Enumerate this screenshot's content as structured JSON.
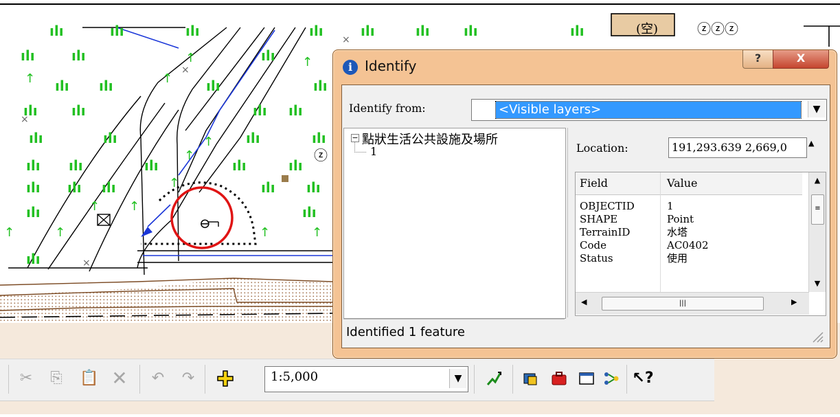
{
  "identify": {
    "title": "Identify",
    "help_label": "?",
    "close_label": "X",
    "identify_from_label": "Identify from:",
    "identify_from_value": "<Visible layers>",
    "layer_name": "點狀生活公共設施及場所",
    "feature_id": "1",
    "location_label": "Location:",
    "location_value": "191,293.639  2,669,0",
    "columns": [
      "Field",
      "Value"
    ],
    "rows": [
      {
        "field": "OBJECTID",
        "value": "1"
      },
      {
        "field": "SHAPE",
        "value": "Point"
      },
      {
        "field": "TerrainID",
        "value": "水塔"
      },
      {
        "field": "Code",
        "value": "AC0402"
      },
      {
        "field": "Status",
        "value": "使用"
      }
    ],
    "status": "Identified 1 feature"
  },
  "toolbar": {
    "scale": "1:5,000"
  },
  "map": {
    "label_open": "(空)",
    "label_zzz": "ⓩⓩⓩ",
    "label_z": "ⓩ"
  },
  "icons": {
    "toolbar": [
      "cut-icon",
      "copy-icon",
      "paste-icon",
      "delete-icon",
      "undo-icon",
      "redo-icon",
      "add-data-icon",
      "editor-icon",
      "arctoolbox-icon",
      "toolbox-icon",
      "python-window-icon",
      "modelbuilder-icon",
      "whats-this-icon"
    ]
  }
}
